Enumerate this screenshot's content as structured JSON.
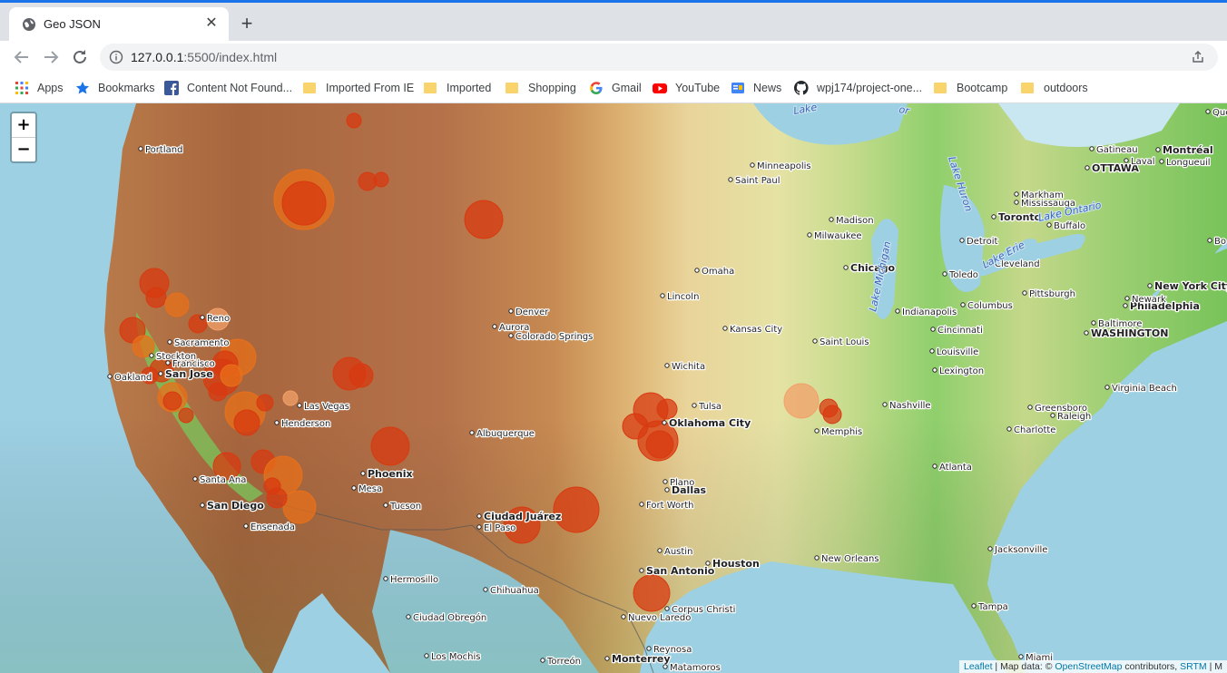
{
  "browser": {
    "tab": {
      "title": "Geo JSON",
      "close_glyph": "✕"
    },
    "new_tab_glyph": "+",
    "url": {
      "host": "127.0.0.1",
      "rest": ":5500/index.html"
    }
  },
  "bookmarks": [
    {
      "label": "Apps",
      "icon": "apps-grid-icon"
    },
    {
      "label": "Bookmarks",
      "icon": "star-icon"
    },
    {
      "label": "Content Not Found...",
      "icon": "facebook-icon"
    },
    {
      "label": "Imported From IE",
      "icon": "folder-icon"
    },
    {
      "label": "Imported",
      "icon": "folder-icon"
    },
    {
      "label": "Shopping",
      "icon": "folder-icon"
    },
    {
      "label": "Gmail",
      "icon": "google-icon"
    },
    {
      "label": "YouTube",
      "icon": "youtube-icon"
    },
    {
      "label": "News",
      "icon": "google-news-icon"
    },
    {
      "label": "wpj174/project-one...",
      "icon": "github-icon"
    },
    {
      "label": "Bootcamp",
      "icon": "folder-icon"
    },
    {
      "label": "outdoors",
      "icon": "folder-icon"
    }
  ],
  "map": {
    "zoom_in": "+",
    "zoom_out": "−",
    "attribution": {
      "leaflet": "Leaflet",
      "sep": " | Map data: © ",
      "osm": "OpenStreetMap",
      "contrib": " contributors, ",
      "srtm": "SRTM",
      "tail": " | M"
    },
    "marker_colors": [
      "#d83a10",
      "#e8701a",
      "#f2a06a"
    ],
    "cities": [
      {
        "name": "Portland",
        "cap": false
      },
      {
        "name": "Sacramento",
        "cap": false
      },
      {
        "name": "Stockton",
        "cap": false
      },
      {
        "name": "Oakland",
        "cap": false
      },
      {
        "name": "San Jose",
        "cap": true
      },
      {
        "name": "Francisco",
        "cap": false
      },
      {
        "name": "Reno",
        "cap": false
      },
      {
        "name": "Las Vegas",
        "cap": false
      },
      {
        "name": "Henderson",
        "cap": false
      },
      {
        "name": "Santa Ana",
        "cap": false
      },
      {
        "name": "San Diego",
        "cap": true
      },
      {
        "name": "Ensenada",
        "cap": false
      },
      {
        "name": "Phoenix",
        "cap": true
      },
      {
        "name": "Mesa",
        "cap": false
      },
      {
        "name": "Tucson",
        "cap": false
      },
      {
        "name": "Hermosillo",
        "cap": false
      },
      {
        "name": "Ciudad Obregón",
        "cap": false
      },
      {
        "name": "Los Mochis",
        "cap": false
      },
      {
        "name": "Chihuahua",
        "cap": false
      },
      {
        "name": "Ciudad Juárez",
        "cap": true
      },
      {
        "name": "El Paso",
        "cap": false
      },
      {
        "name": "Albuquerque",
        "cap": false
      },
      {
        "name": "Denver",
        "cap": false
      },
      {
        "name": "Aurora",
        "cap": false
      },
      {
        "name": "Colorado Springs",
        "cap": false
      },
      {
        "name": "Omaha",
        "cap": false
      },
      {
        "name": "Lincoln",
        "cap": false
      },
      {
        "name": "Minneapolis",
        "cap": false
      },
      {
        "name": "Saint Paul",
        "cap": false
      },
      {
        "name": "Madison",
        "cap": false
      },
      {
        "name": "Milwaukee",
        "cap": false
      },
      {
        "name": "Chicago",
        "cap": true
      },
      {
        "name": "Kansas City",
        "cap": false
      },
      {
        "name": "Wichita",
        "cap": false
      },
      {
        "name": "Tulsa",
        "cap": false
      },
      {
        "name": "Oklahoma City",
        "cap": true
      },
      {
        "name": "Saint Louis",
        "cap": false
      },
      {
        "name": "Memphis",
        "cap": false
      },
      {
        "name": "Nashville",
        "cap": false
      },
      {
        "name": "Plano",
        "cap": false
      },
      {
        "name": "Dallas",
        "cap": true
      },
      {
        "name": "Fort Worth",
        "cap": false
      },
      {
        "name": "Austin",
        "cap": false
      },
      {
        "name": "San Antonio",
        "cap": true
      },
      {
        "name": "Houston",
        "cap": true
      },
      {
        "name": "Corpus Christi",
        "cap": false
      },
      {
        "name": "Nuevo Laredo",
        "cap": false
      },
      {
        "name": "Reynosa",
        "cap": false
      },
      {
        "name": "Monterrey",
        "cap": true
      },
      {
        "name": "Matamoros",
        "cap": false
      },
      {
        "name": "Torreón",
        "cap": false
      },
      {
        "name": "New Orleans",
        "cap": false
      },
      {
        "name": "Atlanta",
        "cap": false
      },
      {
        "name": "Jacksonville",
        "cap": false
      },
      {
        "name": "Tampa",
        "cap": false
      },
      {
        "name": "Miami",
        "cap": false
      },
      {
        "name": "Charlotte",
        "cap": false
      },
      {
        "name": "Greensboro",
        "cap": false
      },
      {
        "name": "Raleigh",
        "cap": false
      },
      {
        "name": "Virginia Beach",
        "cap": false
      },
      {
        "name": "WASHINGTON",
        "cap": true
      },
      {
        "name": "Baltimore",
        "cap": false
      },
      {
        "name": "Philadelphia",
        "cap": true
      },
      {
        "name": "Newark",
        "cap": false
      },
      {
        "name": "New York City",
        "cap": true
      },
      {
        "name": "Pittsburgh",
        "cap": false
      },
      {
        "name": "Columbus",
        "cap": false
      },
      {
        "name": "Indianapolis",
        "cap": false
      },
      {
        "name": "Cincinnati",
        "cap": false
      },
      {
        "name": "Louisville",
        "cap": false
      },
      {
        "name": "Lexington",
        "cap": false
      },
      {
        "name": "Cleveland",
        "cap": false
      },
      {
        "name": "Toledo",
        "cap": false
      },
      {
        "name": "Detroit",
        "cap": false
      },
      {
        "name": "Toronto",
        "cap": true
      },
      {
        "name": "Buffalo",
        "cap": false
      },
      {
        "name": "Mississauga",
        "cap": false
      },
      {
        "name": "Markham",
        "cap": false
      },
      {
        "name": "OTTAWA",
        "cap": true
      },
      {
        "name": "Gatineau",
        "cap": false
      },
      {
        "name": "Laval",
        "cap": false
      },
      {
        "name": "Montréal",
        "cap": true
      },
      {
        "name": "Longueuil",
        "cap": false
      },
      {
        "name": "Que",
        "cap": false
      },
      {
        "name": "Bo",
        "cap": false
      }
    ],
    "lakes": [
      "Lake Michigan",
      "Lake Huron",
      "Lake Erie",
      "Lake Ontario",
      "Lake",
      "or"
    ]
  }
}
